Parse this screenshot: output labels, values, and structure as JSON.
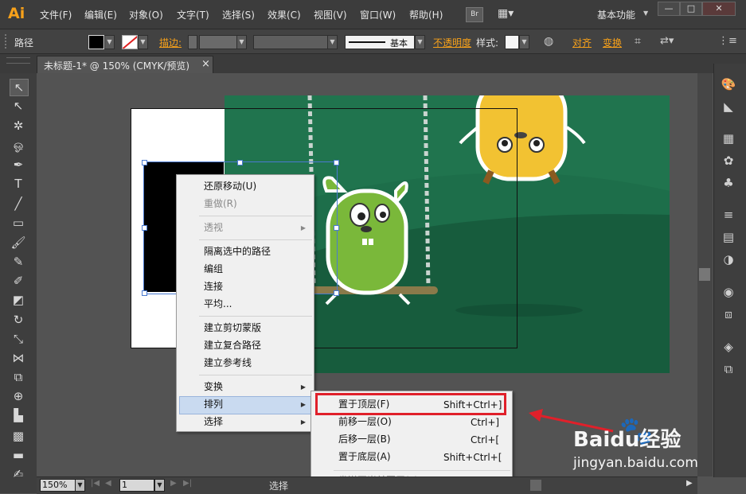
{
  "app": {
    "logo": "Ai",
    "workspace": "基本功能"
  },
  "menubar": {
    "items": [
      "文件(F)",
      "编辑(E)",
      "对象(O)",
      "文字(T)",
      "选择(S)",
      "效果(C)",
      "视图(V)",
      "窗口(W)",
      "帮助(H)"
    ],
    "bridge": "Br"
  },
  "controlbar": {
    "object_type": "路径",
    "stroke_label": "描边:",
    "stroke_style": "基本",
    "opacity_label": "不透明度",
    "style_label": "样式:",
    "align_label": "对齐",
    "transform_label": "变换"
  },
  "document_tab": {
    "title": "未标题-1* @ 150% (CMYK/预览)",
    "close": "×"
  },
  "status": {
    "zoom": "150%",
    "page": "1",
    "tool": "选择"
  },
  "context_menu": {
    "items": [
      "还原移动(U)",
      "重做(R)",
      "透视",
      "隔离选中的路径",
      "编组",
      "连接",
      "平均...",
      "建立剪切蒙版",
      "建立复合路径",
      "建立参考线",
      "变换",
      "排列",
      "选择"
    ],
    "disabled": [
      "重做(R)",
      "透视"
    ],
    "submenu_items": [
      "变换",
      "排列",
      "选择",
      "透视"
    ]
  },
  "arrange_submenu": {
    "items": [
      {
        "label": "置于顶层(F)",
        "shortcut": "Shift+Ctrl+]"
      },
      {
        "label": "前移一层(O)",
        "shortcut": "Ctrl+]"
      },
      {
        "label": "后移一层(B)",
        "shortcut": "Ctrl+["
      },
      {
        "label": "置于底层(A)",
        "shortcut": "Shift+Ctrl+["
      },
      {
        "label": "发送至当前图层(L)",
        "shortcut": ""
      }
    ]
  },
  "watermark": {
    "brand": "Baidu经验",
    "url": "jingyan.baidu.com"
  },
  "colors": {
    "accent": "#f7a11a",
    "highlight_box": "#e0202a",
    "canvas_green": "#1a6a48",
    "selection": "#4a7ad0"
  }
}
